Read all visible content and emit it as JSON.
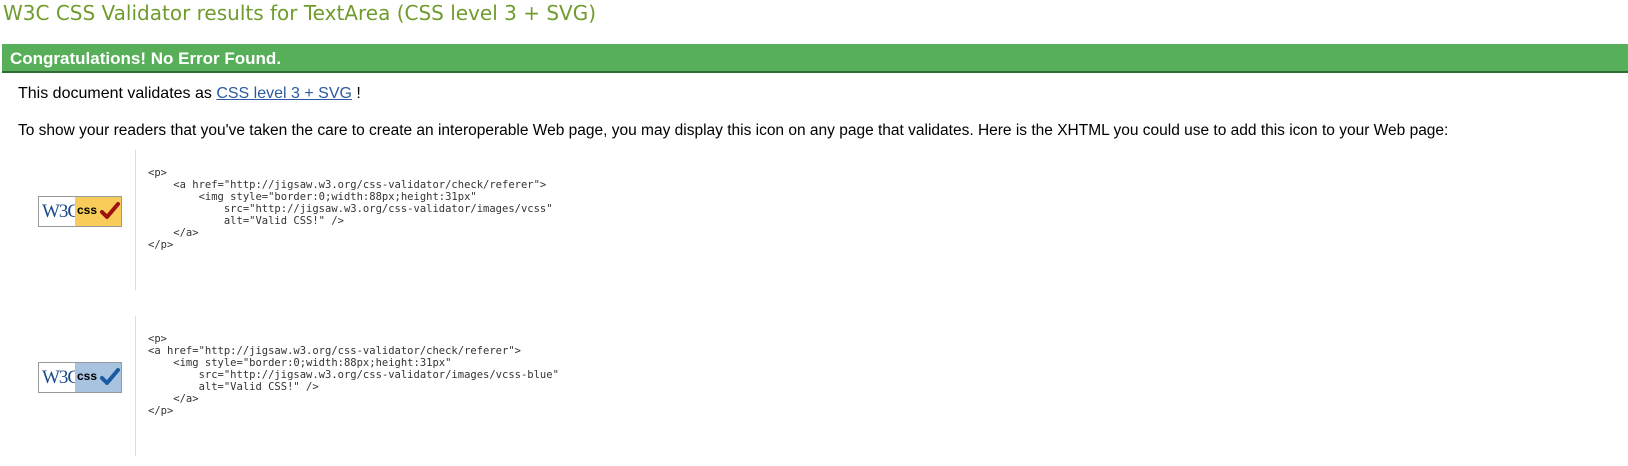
{
  "page": {
    "title": "W3C CSS Validator results for TextArea (CSS level 3 + SVG)"
  },
  "banner": {
    "text": "Congratulations! No Error Found."
  },
  "validates": {
    "prefix": "This document validates as ",
    "link": "CSS level 3 + SVG",
    "suffix": " !"
  },
  "readers_text": "To show your readers that you've taken the care to create an interoperable Web page, you may display this icon on any page that validates. Here is the XHTML you could use to add this icon to your Web page:",
  "badges": [
    {
      "w3c_text": "W3C",
      "css_text": "css",
      "style": "gold",
      "icon": "w3c-css-valid-gold-icon",
      "code": "<p>\n    <a href=\"http://jigsaw.w3.org/css-validator/check/referer\">\n        <img style=\"border:0;width:88px;height:31px\"\n            src=\"http://jigsaw.w3.org/css-validator/images/vcss\"\n            alt=\"Valid CSS!\" />\n    </a>\n</p>"
    },
    {
      "w3c_text": "W3C",
      "css_text": "css",
      "style": "blue",
      "icon": "w3c-css-valid-blue-icon",
      "code": "<p>\n<a href=\"http://jigsaw.w3.org/css-validator/check/referer\">\n    <img style=\"border:0;width:88px;height:31px\"\n        src=\"http://jigsaw.w3.org/css-validator/images/vcss-blue\"\n        alt=\"Valid CSS!\" />\n    </a>\n</p>"
    }
  ],
  "colors": {
    "title": "#6f9c2d",
    "banner": "#58af5a",
    "link": "#2c5aa0",
    "check_gold": "#a01010",
    "check_blue": "#1a5aa0"
  }
}
